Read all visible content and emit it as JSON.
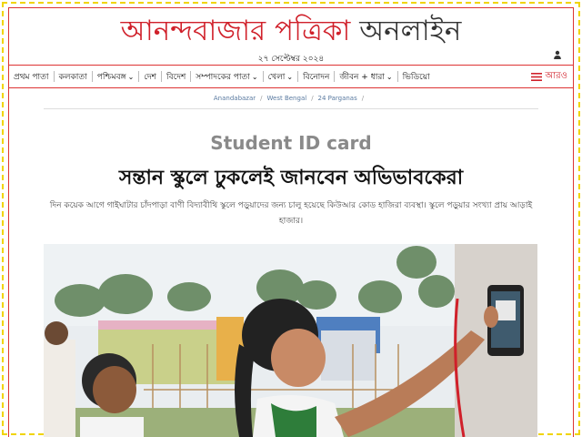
{
  "masthead": {
    "name_red": "আনন্দবাজার পত্রিকা",
    "name_dark": "অনলাইন"
  },
  "date": "২৭ সেপ্টেম্বর ২০২৪",
  "nav": {
    "items": [
      {
        "label": "প্রথম পাতা",
        "dropdown": false
      },
      {
        "label": "কলকাতা",
        "dropdown": false
      },
      {
        "label": "পশ্চিমবঙ্গ",
        "dropdown": true
      },
      {
        "label": "দেশ",
        "dropdown": false
      },
      {
        "label": "বিদেশ",
        "dropdown": false
      },
      {
        "label": "সম্পাদকের পাতা",
        "dropdown": true
      },
      {
        "label": "খেলা",
        "dropdown": true
      },
      {
        "label": "বিনোদন",
        "dropdown": false
      },
      {
        "label": "জীবন + ধারা",
        "dropdown": true
      },
      {
        "label": "ভিডিয়ো",
        "dropdown": false
      }
    ],
    "more_label": "আরও",
    "icons": {
      "menu": "hamburger-menu-icon",
      "chevron": "chevron-down-icon",
      "user": "user-icon"
    }
  },
  "breadcrumb": [
    "Anandabazar",
    "West Bengal",
    "24 Parganas"
  ],
  "article": {
    "kicker": "Student ID card",
    "headline": "সন্তান স্কুলে ঢুকলেই জানবেন অভিভাবকেরা",
    "standfirst": "দিন কয়েক আগে গাইঘাটার চাঁদপাড়া বাণী বিদ্যাবীথি স্কুলে পড়ুয়াদের জন্য চালু হয়েছে কিউআর কোড হাজিরা ব্যবস্থা। স্কুলে পড়ুয়ার সংখ্যা প্রায় আড়াই হাজার।"
  },
  "colors": {
    "brand_red": "#d0202a",
    "border_yellow": "#f0d400"
  }
}
